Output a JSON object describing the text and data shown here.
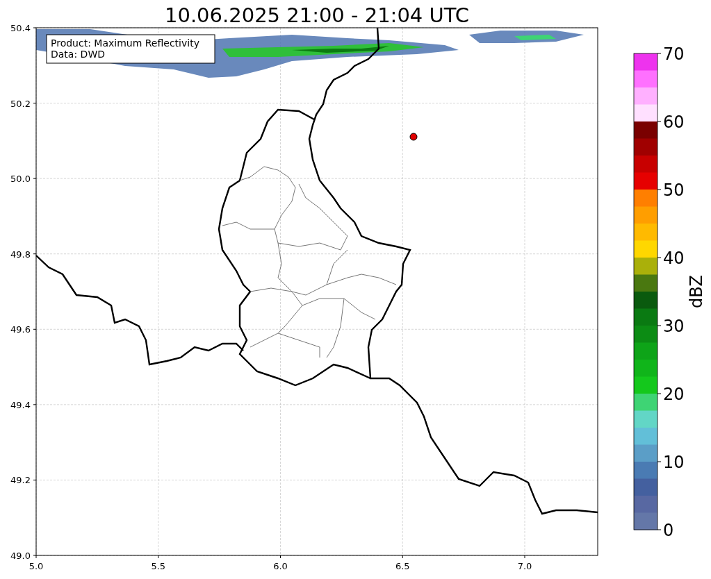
{
  "title": "10.06.2025 21:00 - 21:04 UTC",
  "info_box": [
    "Product: Maximum Reflectivity",
    "Data: DWD"
  ],
  "x_axis": {
    "ticks": [
      "5.0",
      "5.5",
      "6.0",
      "6.5",
      "7.0"
    ]
  },
  "y_axis": {
    "ticks": [
      "50.4",
      "50.2",
      "50.0",
      "49.8",
      "49.6",
      "49.4",
      "49.2",
      "49.0"
    ]
  },
  "colorbar": {
    "label": "dBZ",
    "ticks": [
      "70",
      "60",
      "50",
      "40",
      "30",
      "20",
      "10",
      "0"
    ],
    "segments": [
      {
        "color": "#ee33ee"
      },
      {
        "color": "#ff70ff"
      },
      {
        "color": "#ffb0ff"
      },
      {
        "color": "#ffe0ff"
      },
      {
        "color": "#7a0000"
      },
      {
        "color": "#a00000"
      },
      {
        "color": "#c80000"
      },
      {
        "color": "#e60000"
      },
      {
        "color": "#ff7f00"
      },
      {
        "color": "#ff9e00"
      },
      {
        "color": "#ffba00"
      },
      {
        "color": "#ffd700"
      },
      {
        "color": "#aab00a"
      },
      {
        "color": "#4a7810"
      },
      {
        "color": "#0a5a0e"
      },
      {
        "color": "#0a7a12"
      },
      {
        "color": "#0c8c14"
      },
      {
        "color": "#0ea418"
      },
      {
        "color": "#10b51a"
      },
      {
        "color": "#14c81c"
      },
      {
        "color": "#3ed474"
      },
      {
        "color": "#62d6c6"
      },
      {
        "color": "#62bfd8"
      },
      {
        "color": "#5b9ec7"
      },
      {
        "color": "#4a7bb3"
      },
      {
        "color": "#44609f"
      },
      {
        "color": "#5868a2"
      },
      {
        "color": "#6477a8"
      }
    ]
  }
}
